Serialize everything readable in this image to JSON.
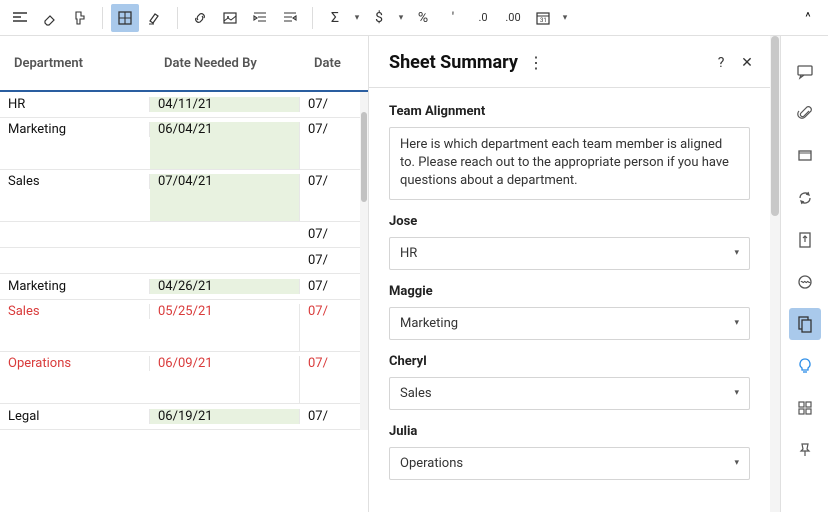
{
  "toolbar_sym": {
    "sigma": "Σ",
    "dollar": "$",
    "percent": "%",
    "quote": "'",
    "dec_less": ".0",
    "dec_more": ".00"
  },
  "collapse_caret": "^",
  "grid": {
    "headers": [
      "Department",
      "Date Needed By",
      "Date"
    ],
    "rows": [
      {
        "dept": "HR",
        "date": "04/11/21",
        "d2": "07/",
        "green": true,
        "red": false
      },
      {
        "dept": "Marketing",
        "date": "06/04/21",
        "d2": "07/",
        "green": true,
        "red": false
      },
      {
        "dept": "Sales",
        "date": "07/04/21",
        "d2": "07/",
        "green": true,
        "red": false
      },
      {
        "dept": "",
        "date": "",
        "d2": "07/",
        "green": false,
        "red": false
      },
      {
        "dept": "",
        "date": "",
        "d2": "07/",
        "green": false,
        "red": false
      },
      {
        "dept": "Marketing",
        "date": "04/26/21",
        "d2": "07/",
        "green": true,
        "red": false
      },
      {
        "dept": "Sales",
        "date": "05/25/21",
        "d2": "07/",
        "green": false,
        "red": true
      },
      {
        "dept": "Operations",
        "date": "06/09/21",
        "d2": "07/",
        "green": false,
        "red": true
      },
      {
        "dept": "Legal",
        "date": "06/19/21",
        "d2": "07/",
        "green": true,
        "red": false
      }
    ]
  },
  "panel": {
    "title": "Sheet Summary",
    "help": "?",
    "close": "✕",
    "fields": {
      "team_alignment": {
        "label": "Team Alignment",
        "value": "Here is which department each team member is aligned to. Please reach out to the appropriate person if you have questions about a department."
      },
      "jose": {
        "label": "Jose",
        "value": "HR"
      },
      "maggie": {
        "label": "Maggie",
        "value": "Marketing"
      },
      "cheryl": {
        "label": "Cheryl",
        "value": "Sales"
      },
      "julia": {
        "label": "Julia",
        "value": "Operations"
      }
    }
  }
}
